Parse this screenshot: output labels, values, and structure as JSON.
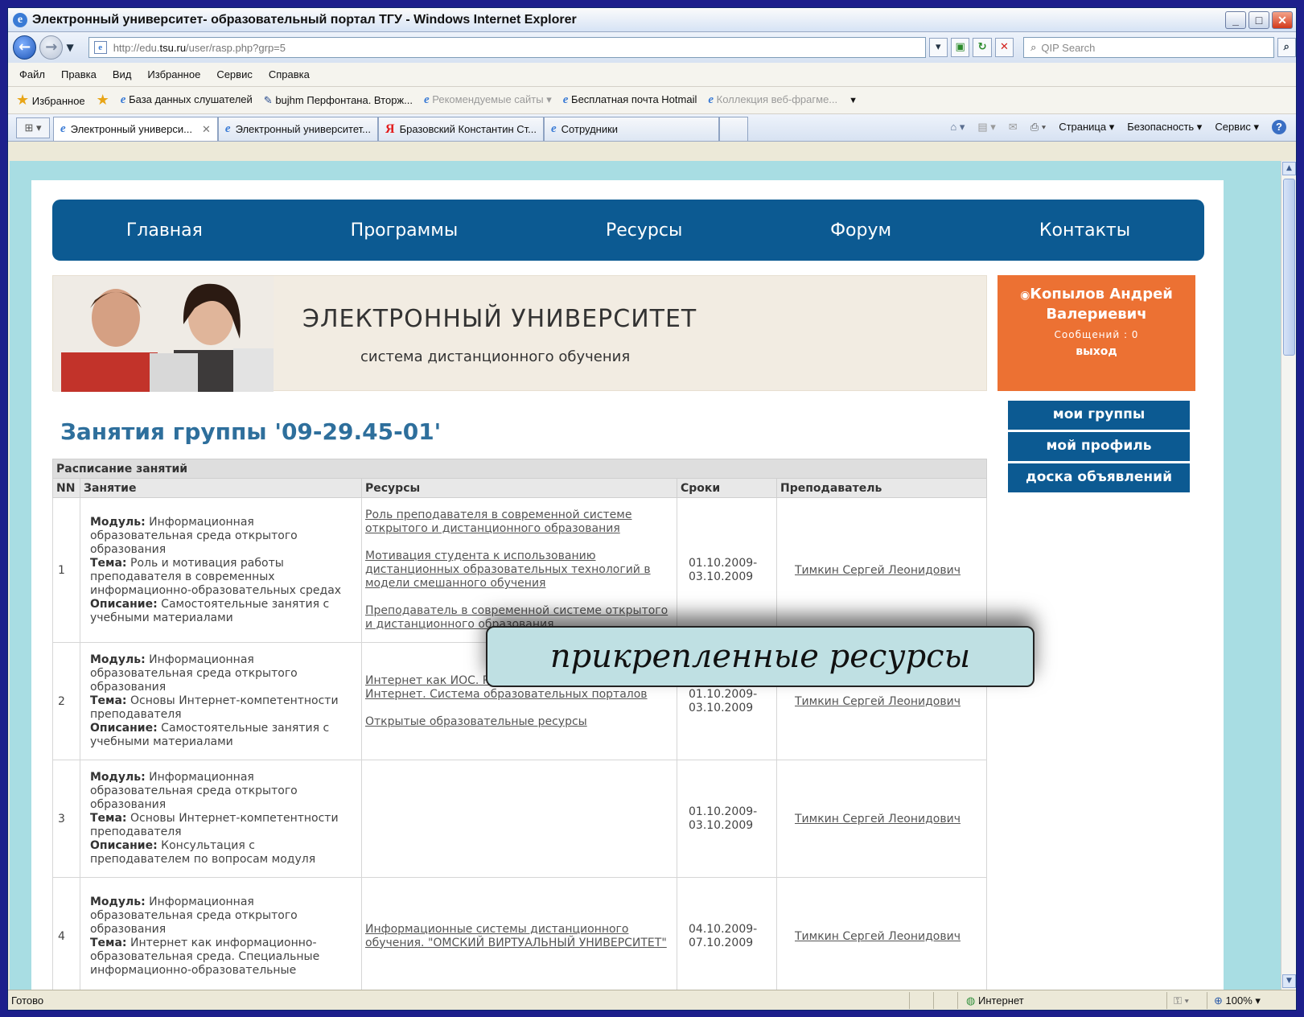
{
  "window": {
    "title": "Электронный университет- образовательный портал ТГУ - Windows Internet Explorer",
    "buttons": [
      "_",
      "□",
      "✕"
    ]
  },
  "address": {
    "url_prefix": "http://edu.",
    "url_domain": "tsu.ru",
    "url_path": "/user/rasp.php?grp=5",
    "search_placeholder": "QIP Search"
  },
  "menu": [
    "Файл",
    "Правка",
    "Вид",
    "Избранное",
    "Сервис",
    "Справка"
  ],
  "favorites": {
    "label": "Избранное",
    "items": [
      {
        "label": "База данных слушателей",
        "dim": false
      },
      {
        "label": "bujhm Перфонтана. Вторж...",
        "dim": false
      },
      {
        "label": "Рекомендуемые сайты",
        "dim": true
      },
      {
        "label": "Бесплатная почта Hotmail",
        "dim": false
      },
      {
        "label": "Коллекция веб-фрагме...",
        "dim": true
      }
    ]
  },
  "tabs": [
    {
      "label": "Электронный универси...",
      "active": true
    },
    {
      "label": "Электронный университет...",
      "active": false
    },
    {
      "label": "Бразовский Константин Ст...",
      "active": false
    },
    {
      "label": "Сотрудники",
      "active": false
    }
  ],
  "command_bar": {
    "page": "Страница",
    "security": "Безопасность",
    "tools": "Сервис"
  },
  "site": {
    "nav": [
      "Главная",
      "Программы",
      "Ресурсы",
      "Форум",
      "Контакты"
    ],
    "banner_title": "ЭЛЕКТРОННЫЙ УНИВЕРСИТЕТ",
    "banner_subtitle": "система дистанционного обучения",
    "user": {
      "name_line1": "Копылов Андрей",
      "name_line2": "Валериевич",
      "messages": "Сообщений : 0",
      "logout": "выход"
    },
    "side_menu": [
      "мои группы",
      "мой профиль",
      "доска объявлений"
    ],
    "page_title": "Занятия группы '09-29.45-01'",
    "schedule": {
      "caption": "Расписание занятий",
      "headers": [
        "NN",
        "Занятие",
        "Ресурсы",
        "Сроки",
        "Преподаватель"
      ],
      "label_module": "Модуль:",
      "label_topic": "Тема:",
      "label_desc": "Описание:",
      "rows": [
        {
          "nn": "1",
          "module": "Информационная образовательная среда открытого образования",
          "topic": "Роль и мотивация работы преподавателя в современных информационно-образовательных средах",
          "desc": "Самостоятельные занятия с учебными материалами",
          "resources": [
            "Роль преподавателя в современной системе открытого и дистанционного образования",
            "Мотивация студента к использованию дистанционных образовательных технологий в модели смешанного обучения",
            "Преподаватель в современной системе открытого и дистанционного образования"
          ],
          "dates": "01.10.2009-\n03.10.2009",
          "teacher": "Тимкин Сергей Леонидович"
        },
        {
          "nn": "2",
          "module": "Информационная образовательная среда открытого образования",
          "topic": "Основы Интернет-компетентности преподавателя",
          "desc": "Самостоятельные занятия с учебными материалами",
          "resources": [
            "Интернет как ИОС. Ресурсы Интернет. Поиск в Интернет. Система образовательных порталов",
            "Открытые образовательные ресурсы"
          ],
          "dates": "01.10.2009-\n03.10.2009",
          "teacher": "Тимкин Сергей Леонидович"
        },
        {
          "nn": "3",
          "module": "Информационная образовательная среда открытого образования",
          "topic": "Основы Интернет-компетентности преподавателя",
          "desc": "Консультация с преподавателем по вопросам модуля",
          "resources": [],
          "dates": "01.10.2009-\n03.10.2009",
          "teacher": "Тимкин Сергей Леонидович"
        },
        {
          "nn": "4",
          "module": "Информационная образовательная среда открытого образования",
          "topic": "Интернет как информационно-образовательная среда. Специальные информационно-образовательные",
          "desc": "",
          "resources": [
            "Информационные системы дистанционного обучения. \"ОМСКИЙ ВИРТУАЛЬНЫЙ УНИВЕРСИТЕТ\""
          ],
          "dates": "04.10.2009-\n07.10.2009",
          "teacher": "Тимкин Сергей Леонидович"
        }
      ]
    }
  },
  "callout": "прикрепленные ресурсы",
  "status": {
    "left": "Готово",
    "zone": "Интернет",
    "zoom": "100%"
  },
  "colors": {
    "nav_blue": "#0c5a92",
    "user_orange": "#ec7133",
    "title_blue": "#2e6f9c",
    "viewport_bg": "#a8dde3",
    "slide_bg": "#1d1f8c"
  }
}
